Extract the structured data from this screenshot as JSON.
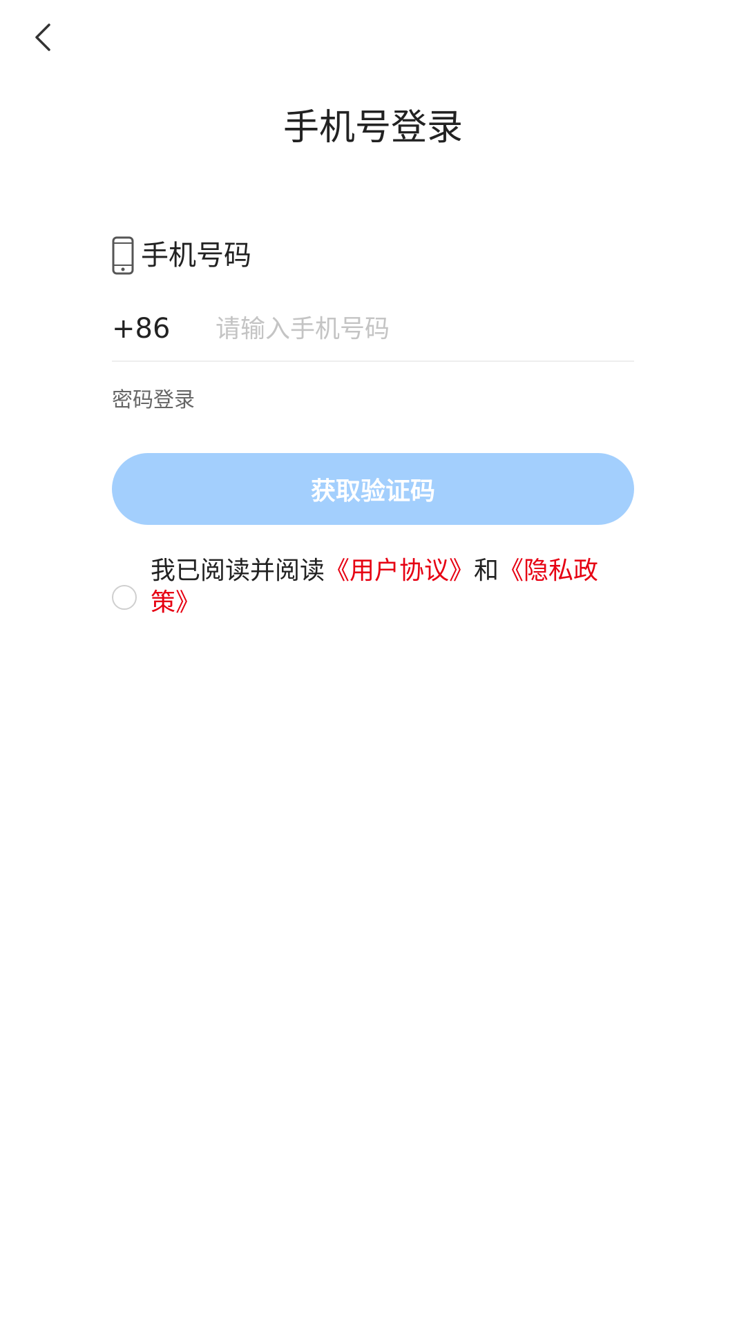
{
  "header": {
    "back_icon": "chevron-left-icon",
    "title": "手机号登录"
  },
  "phone_field": {
    "icon": "phone-icon",
    "label": "手机号码",
    "country_code": "+86",
    "placeholder": "请输入手机号码",
    "value": ""
  },
  "password_login_label": "密码登录",
  "get_code_button": {
    "label": "获取验证码",
    "color": "#a3cffd"
  },
  "agreement": {
    "checked": false,
    "prefix": "我已阅读并阅读",
    "user_agreement": "《用户协议》",
    "connector": "和",
    "privacy_policy": "《隐私政策》",
    "link_color": "#e60012"
  }
}
